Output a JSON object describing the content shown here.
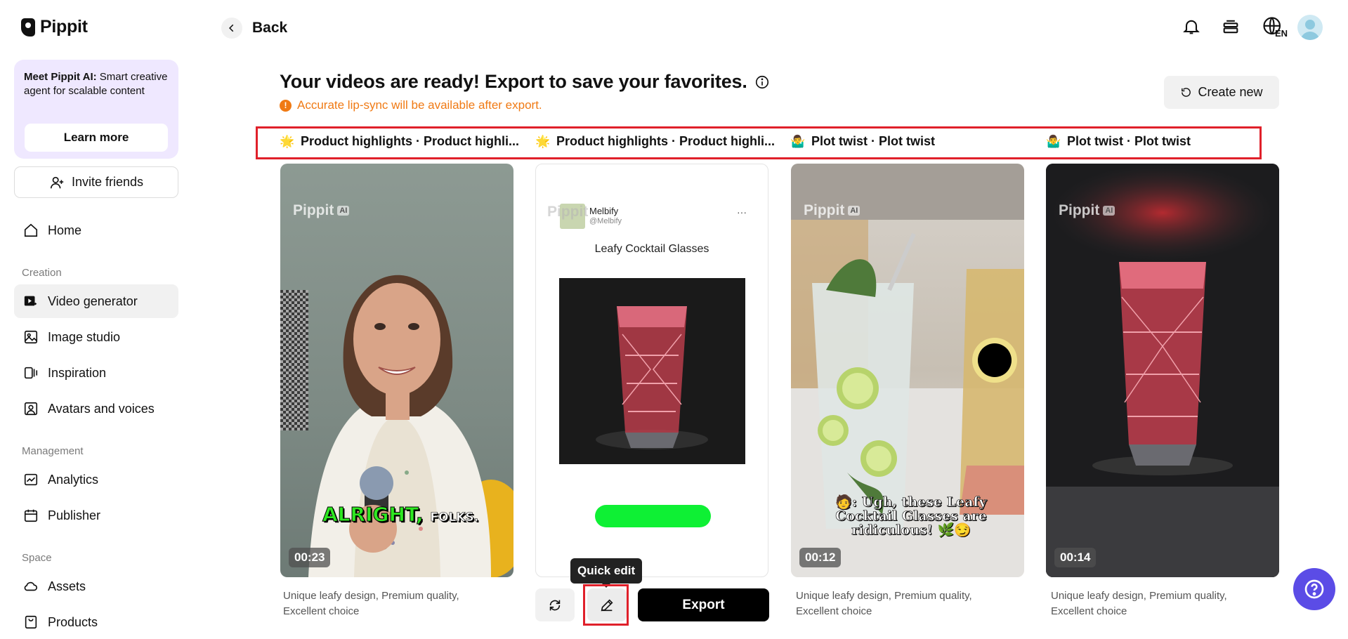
{
  "app": {
    "name": "Pippit"
  },
  "sidebar": {
    "promo": {
      "title": "Meet Pippit AI:",
      "text": " Smart creative agent for scalable content",
      "button": "Learn more"
    },
    "invite_label": "Invite friends",
    "home_label": "Home",
    "sections": {
      "creation": "Creation",
      "management": "Management",
      "space": "Space"
    },
    "items": {
      "video_generator": "Video generator",
      "image_studio": "Image studio",
      "inspiration": "Inspiration",
      "avatars": "Avatars and voices",
      "analytics": "Analytics",
      "publisher": "Publisher",
      "assets": "Assets",
      "products": "Products"
    }
  },
  "header": {
    "back_label": "Back",
    "language": "EN"
  },
  "main": {
    "headline": "Your videos are ready! Export to save your favorites.",
    "notice": "Accurate lip-sync will be available after export.",
    "create_new": "Create new",
    "tabs": [
      {
        "emoji": "🌟",
        "label": "Product highlights · Product highli..."
      },
      {
        "emoji": "🌟",
        "label": "Product highlights · Product highli..."
      },
      {
        "emoji": "🤷‍♂️",
        "label": "Plot twist · Plot twist"
      },
      {
        "emoji": "🤷‍♂️",
        "label": "Plot twist · Plot twist"
      }
    ],
    "cards": [
      {
        "duration": "00:23",
        "caption_main": "ALRIGHT,",
        "caption_sub": "FOLKS.",
        "description": "Unique leafy design, Premium quality, Excellent choice",
        "watermark": "Pippit",
        "watermark_badge": "AI"
      },
      {
        "post_author": "Melbify",
        "post_handle": "@Melbify",
        "post_title": "Leafy Cocktail Glasses",
        "watermark": "Pippit",
        "more": "···"
      },
      {
        "duration": "00:12",
        "caption": "🧑: Ugh, these Leafy Cocktail Glasses are ridiculous! 🌿😏",
        "description": "Unique leafy design, Premium quality, Excellent choice",
        "watermark": "Pippit",
        "watermark_badge": "AI"
      },
      {
        "duration": "00:14",
        "description": "Unique leafy design, Premium quality, Excellent choice",
        "watermark": "Pippit",
        "watermark_badge": "AI"
      }
    ],
    "actions": {
      "export": "Export",
      "tooltip": "Quick edit"
    }
  },
  "colors": {
    "accent": "#5b4ce6",
    "warning": "#f07a14",
    "highlight": "#e0202a",
    "promo_bg": "#efe8ff"
  }
}
